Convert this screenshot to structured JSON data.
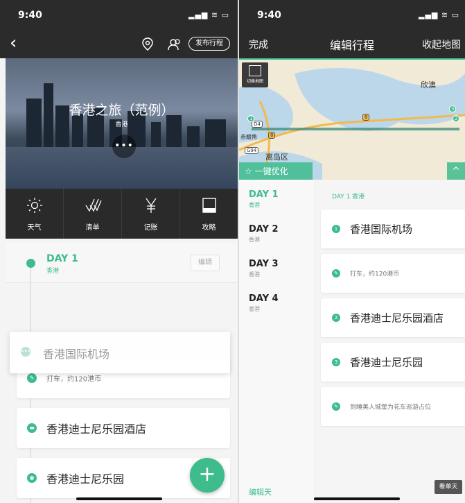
{
  "left": {
    "status": {
      "time": "9:40",
      "icons": "▂▄▆ ≋ ▭"
    },
    "nav": {
      "back_label": "‹",
      "publish_label": "发布行程"
    },
    "hero": {
      "title": "香港之旅（范例）",
      "subtitle": "香港",
      "more_label": "•••"
    },
    "toolbar": [
      {
        "label": "天气",
        "icon": "sun-icon"
      },
      {
        "label": "清单",
        "icon": "checklist-icon"
      },
      {
        "label": "记账",
        "icon": "yen-icon"
      },
      {
        "label": "攻略",
        "icon": "book-icon"
      }
    ],
    "day": {
      "label": "DAY 1",
      "city": "香港",
      "edit_label": "编辑"
    },
    "dragging_item": {
      "name": "香港国际机场",
      "num": "1"
    },
    "items": [
      {
        "type": "note",
        "text": "打车，约120港币"
      },
      {
        "type": "hotel",
        "text": "香港迪士尼乐园酒店"
      },
      {
        "type": "poi",
        "text": "香港迪士尼乐园"
      }
    ],
    "fab_label": "+"
  },
  "right": {
    "status": {
      "time": "9:40",
      "icons": "▂▄▆ ≋ ▭"
    },
    "header": {
      "done_label": "完成",
      "title": "编辑行程",
      "collapse_label": "收起地图"
    },
    "map": {
      "switch_label": "切换地图",
      "labels": [
        "欣澳",
        "赤鱲角",
        "离岛区"
      ],
      "badges": [
        "D4",
        "G94",
        "8",
        "8"
      ],
      "markers": [
        "1",
        "2",
        "3"
      ],
      "optimize_label": "一键优化",
      "expand_label": "^"
    },
    "days": [
      {
        "label": "DAY 1",
        "city": "香港"
      },
      {
        "label": "DAY 2",
        "city": "香港"
      },
      {
        "label": "DAY 3",
        "city": "香港"
      },
      {
        "label": "DAY 4",
        "city": "香港"
      }
    ],
    "edit_day_label": "编辑天",
    "day_header": "DAY 1  香港",
    "items": [
      {
        "num": "1",
        "text": "香港国际机场"
      },
      {
        "num": "",
        "text": "打车，约120港币"
      },
      {
        "num": "2",
        "text": "香港迪士尼乐园酒店"
      },
      {
        "num": "3",
        "text": "香港迪士尼乐园"
      },
      {
        "num": "",
        "text": "到睡美人城堡为花车巡游占位"
      }
    ],
    "view_day_label": "看单天"
  },
  "colors": {
    "accent": "#3ebc8c",
    "header": "#2b2b2b"
  }
}
